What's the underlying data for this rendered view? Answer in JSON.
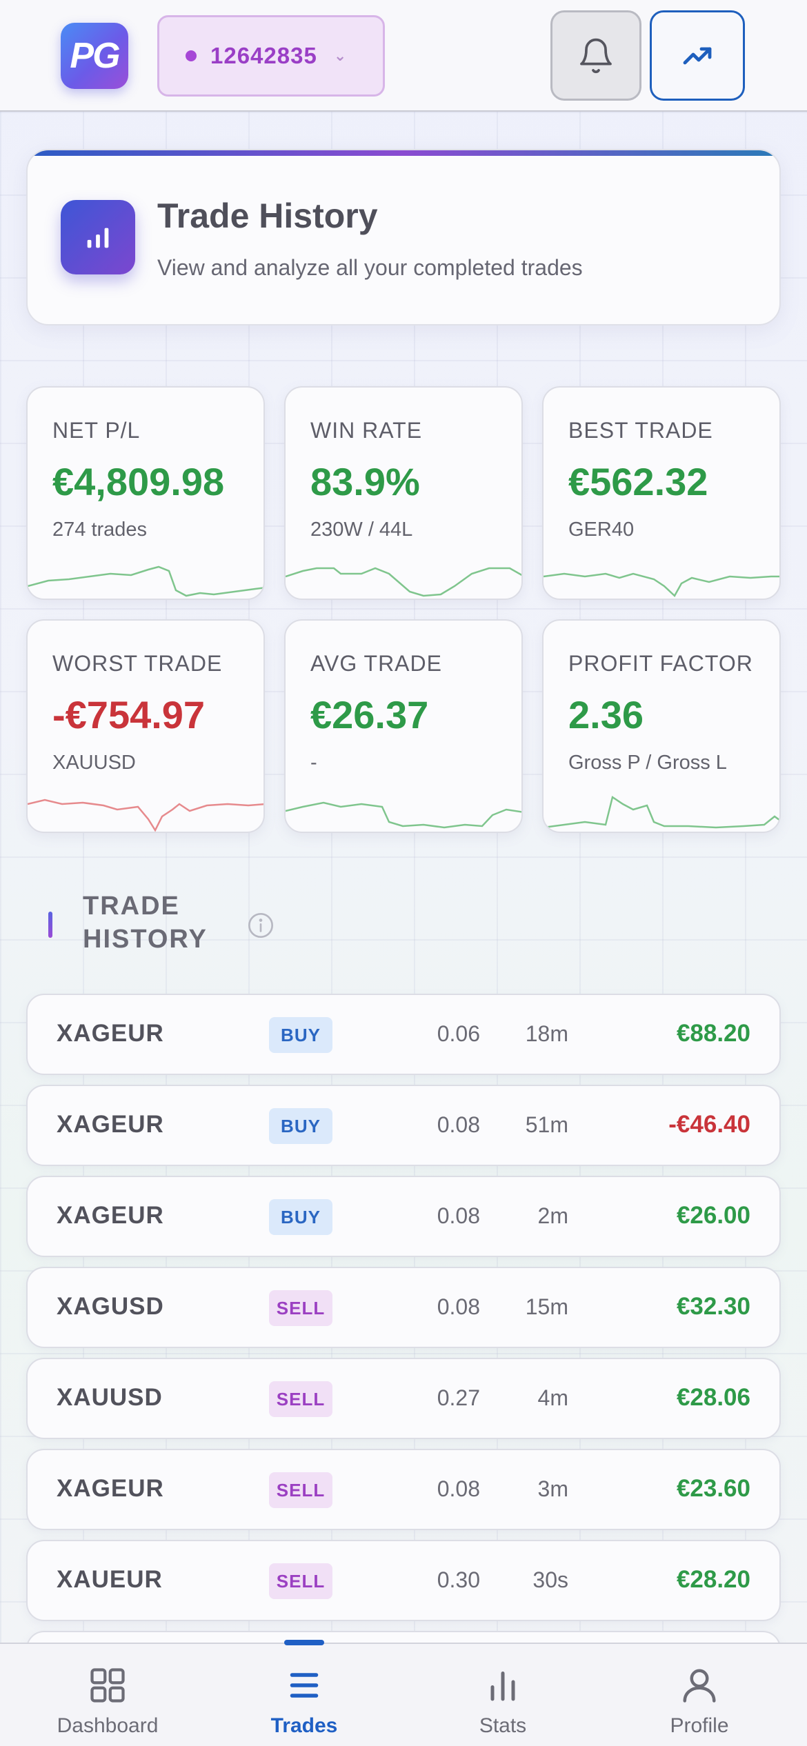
{
  "header": {
    "logo_text": "PG",
    "account_number": "12642835",
    "colors": {
      "accent": "#1e5fbd",
      "account": "#9a3fc6"
    }
  },
  "hero": {
    "title": "Trade History",
    "subtitle": "View and analyze all your completed trades"
  },
  "stats": [
    {
      "label": "NET P/L",
      "value": "€4,809.98",
      "sub": "274 trades",
      "tone": "pos"
    },
    {
      "label": "WIN RATE",
      "value": "83.9%",
      "sub": "230W / 44L",
      "tone": "pos"
    },
    {
      "label": "BEST TRADE",
      "value": "€562.32",
      "sub": "GER40",
      "tone": "pos"
    },
    {
      "label": "WORST TRADE",
      "value": "-€754.97",
      "sub": "XAUUSD",
      "tone": "neg"
    },
    {
      "label": "AVG TRADE",
      "value": "€26.37",
      "sub": "-",
      "tone": "pos"
    },
    {
      "label": "PROFIT FACTOR",
      "value": "2.36",
      "sub": "Gross P / Gross L",
      "tone": "pos"
    }
  ],
  "section": {
    "title": "TRADE HISTORY"
  },
  "trades": [
    {
      "symbol": "XAGEUR",
      "side": "BUY",
      "lot": "0.06",
      "duration": "18m",
      "pnl": "€88.20",
      "tone": "pos"
    },
    {
      "symbol": "XAGEUR",
      "side": "BUY",
      "lot": "0.08",
      "duration": "51m",
      "pnl": "-€46.40",
      "tone": "neg"
    },
    {
      "symbol": "XAGEUR",
      "side": "BUY",
      "lot": "0.08",
      "duration": "2m",
      "pnl": "€26.00",
      "tone": "pos"
    },
    {
      "symbol": "XAGUSD",
      "side": "SELL",
      "lot": "0.08",
      "duration": "15m",
      "pnl": "€32.30",
      "tone": "pos"
    },
    {
      "symbol": "XAUUSD",
      "side": "SELL",
      "lot": "0.27",
      "duration": "4m",
      "pnl": "€28.06",
      "tone": "pos"
    },
    {
      "symbol": "XAGEUR",
      "side": "SELL",
      "lot": "0.08",
      "duration": "3m",
      "pnl": "€23.60",
      "tone": "pos"
    },
    {
      "symbol": "XAUEUR",
      "side": "SELL",
      "lot": "0.30",
      "duration": "30s",
      "pnl": "€28.20",
      "tone": "pos"
    }
  ],
  "nav": [
    {
      "label": "Dashboard",
      "icon": "grid-icon"
    },
    {
      "label": "Trades",
      "icon": "list-icon",
      "active": true
    },
    {
      "label": "Stats",
      "icon": "bar-chart-icon"
    },
    {
      "label": "Profile",
      "icon": "user-icon"
    }
  ]
}
